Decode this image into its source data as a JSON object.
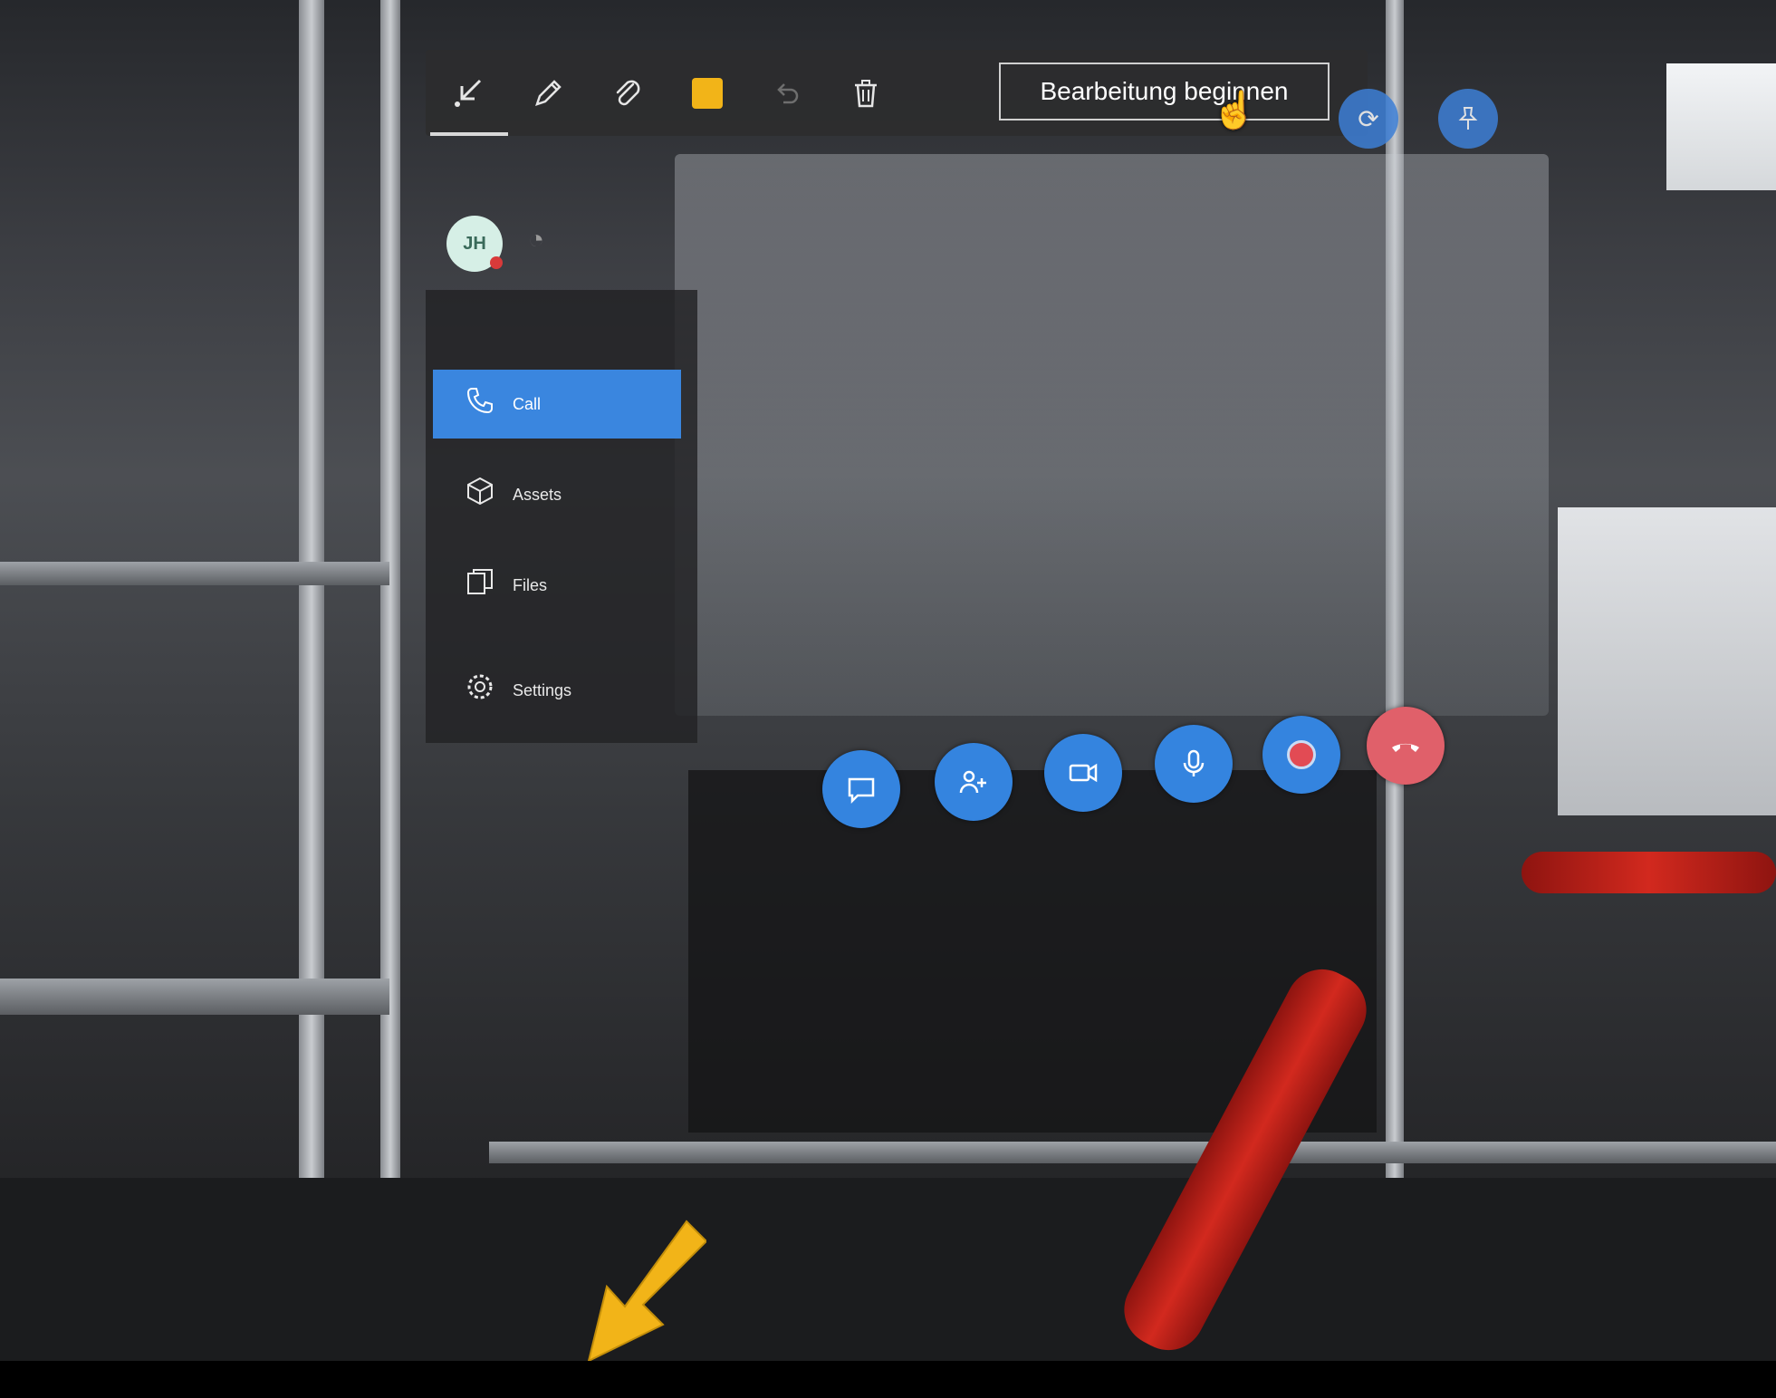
{
  "toolbar": {
    "tools": [
      {
        "name": "arrow-tool",
        "icon": "arrow-down-left-icon",
        "active": true
      },
      {
        "name": "pen-tool",
        "icon": "pencil-icon",
        "active": false
      },
      {
        "name": "attach-tool",
        "icon": "paperclip-icon",
        "active": false
      },
      {
        "name": "color-tool",
        "icon": "color-swatch-icon",
        "color": "#f2b418",
        "active": false
      },
      {
        "name": "undo-tool",
        "icon": "undo-icon",
        "disabled": true
      },
      {
        "name": "delete-tool",
        "icon": "trash-icon",
        "active": false
      }
    ],
    "edit_label": "Bearbeitung beginnen"
  },
  "avatar": {
    "initials": "JH",
    "status_color": "#d83a3a"
  },
  "nav": {
    "items": [
      {
        "label": "Call",
        "icon": "phone-icon",
        "active": true
      },
      {
        "label": "Assets",
        "icon": "cube-icon",
        "active": false
      },
      {
        "label": "Files",
        "icon": "files-icon",
        "active": false
      },
      {
        "label": "Settings",
        "icon": "gear-icon",
        "active": false
      }
    ]
  },
  "call_controls": [
    {
      "name": "chat",
      "icon": "chat-icon"
    },
    {
      "name": "participants",
      "icon": "participants-icon"
    },
    {
      "name": "camera",
      "icon": "video-camera-icon"
    },
    {
      "name": "microphone",
      "icon": "microphone-icon"
    },
    {
      "name": "record",
      "icon": "record-icon"
    },
    {
      "name": "hang-up",
      "icon": "hang-up-icon",
      "color": "#e0606a"
    }
  ],
  "colors": {
    "accent": "#3a86df",
    "annotation": "#f2b418"
  }
}
